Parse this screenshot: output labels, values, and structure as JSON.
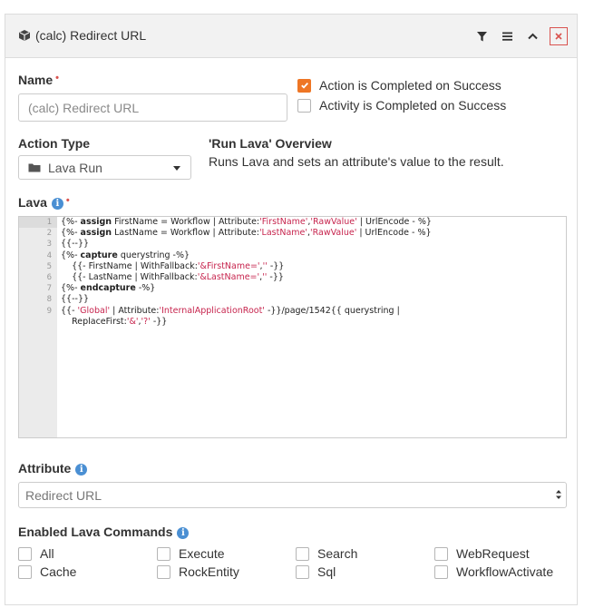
{
  "header": {
    "title": "(calc) Redirect URL",
    "icons": [
      "cube-icon",
      "filter-icon",
      "menu-icon",
      "chevron-up-icon",
      "close-icon"
    ],
    "accent_color": "#d9534f"
  },
  "name_field": {
    "label": "Name",
    "value": "(calc) Redirect URL"
  },
  "flags": {
    "action_completed": {
      "label": "Action is Completed on Success",
      "checked": true
    },
    "activity_completed": {
      "label": "Activity is Completed on Success",
      "checked": false
    },
    "check_color": "#ee7625"
  },
  "action_type": {
    "label": "Action Type",
    "value": "Lava Run",
    "icon": "folder-icon"
  },
  "overview": {
    "title": "'Run Lava' Overview",
    "text": "Runs Lava and sets an attribute's value to the result."
  },
  "lava": {
    "label": "Lava",
    "lines": [
      {
        "num": "1",
        "text": ""
      },
      {
        "num": "2",
        "text": ""
      },
      {
        "num": "3",
        "text": ""
      },
      {
        "num": "4",
        "text": ""
      },
      {
        "num": "5",
        "text": ""
      },
      {
        "num": "6",
        "text": ""
      },
      {
        "num": "7",
        "text": ""
      },
      {
        "num": "8",
        "text": ""
      },
      {
        "num": "9",
        "text": ""
      }
    ],
    "raw": [
      "{%- assign FirstName = Workflow | Attribute:'FirstName','RawValue' | UrlEncode - %}",
      "{%- assign LastName = Workflow | Attribute:'LastName','RawValue' | UrlEncode - %}",
      "{{--}}",
      "{%- capture querystring -%}",
      "    {{- FirstName | WithFallback:'&FirstName=','' -}}",
      "    {{- LastName | WithFallback:'&LastName=','' -}}",
      "{%- endcapture -%}",
      "{{--}}",
      "{{- 'Global' | Attribute:'InternalApplicationRoot' -}}/page/1542{{ querystring |",
      "    ReplaceFirst:'&','?' -}}"
    ]
  },
  "attribute": {
    "label": "Attribute",
    "value": "Redirect URL"
  },
  "commands": {
    "label": "Enabled Lava Commands",
    "items": [
      "All",
      "Execute",
      "Search",
      "WebRequest",
      "Cache",
      "RockEntity",
      "Sql",
      "WorkflowActivate"
    ]
  }
}
